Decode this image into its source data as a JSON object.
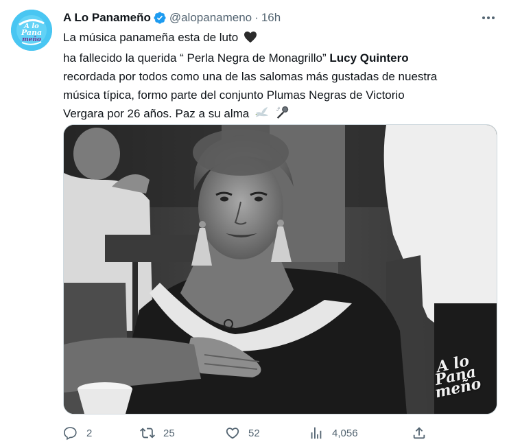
{
  "tweet": {
    "display_name": "A Lo Panameño",
    "handle": "@alopanameno",
    "separator": "·",
    "time": "16h",
    "verified_icon": "verified-badge-icon",
    "more_icon": "more-options-icon",
    "avatar": {
      "logo_lines": [
        "A lo",
        "Pana",
        "meño"
      ],
      "colors": {
        "background": "#3fc2f0",
        "text": "#ffffff",
        "accent": "#7a2a8a"
      }
    },
    "body": {
      "line1": "La música panameña esta de luto",
      "line1_emoji": "black-heart-icon",
      "line2_prefix": "ha fallecido la querida “ Perla Negra de Monagrillo”",
      "line2_bold": "Lucy Quintero",
      "line3": "recordada por todos como una de las salomas más gustadas de nuestra",
      "line4": "música típica,  formo parte del conjunto Plumas Negras de Victorio",
      "line5": "Vergara por 26 años.  Paz a su alma",
      "line5_emojis": [
        "dove-icon",
        "microphone-icon"
      ]
    },
    "media": {
      "description_icon": "photo-elderly-woman",
      "watermark_lines": [
        "A lo",
        "Pana",
        "meño"
      ]
    },
    "actions": {
      "reply": {
        "icon": "reply-icon",
        "count": "2"
      },
      "retweet": {
        "icon": "retweet-icon",
        "count": "25"
      },
      "like": {
        "icon": "heart-icon",
        "count": "52"
      },
      "views": {
        "icon": "views-chart-icon",
        "count": "4,056"
      },
      "share": {
        "icon": "share-icon"
      }
    },
    "colors": {
      "text": "#0f1419",
      "secondary": "#536471",
      "verified": "#1d9bf0",
      "border": "#cfd9de"
    }
  }
}
